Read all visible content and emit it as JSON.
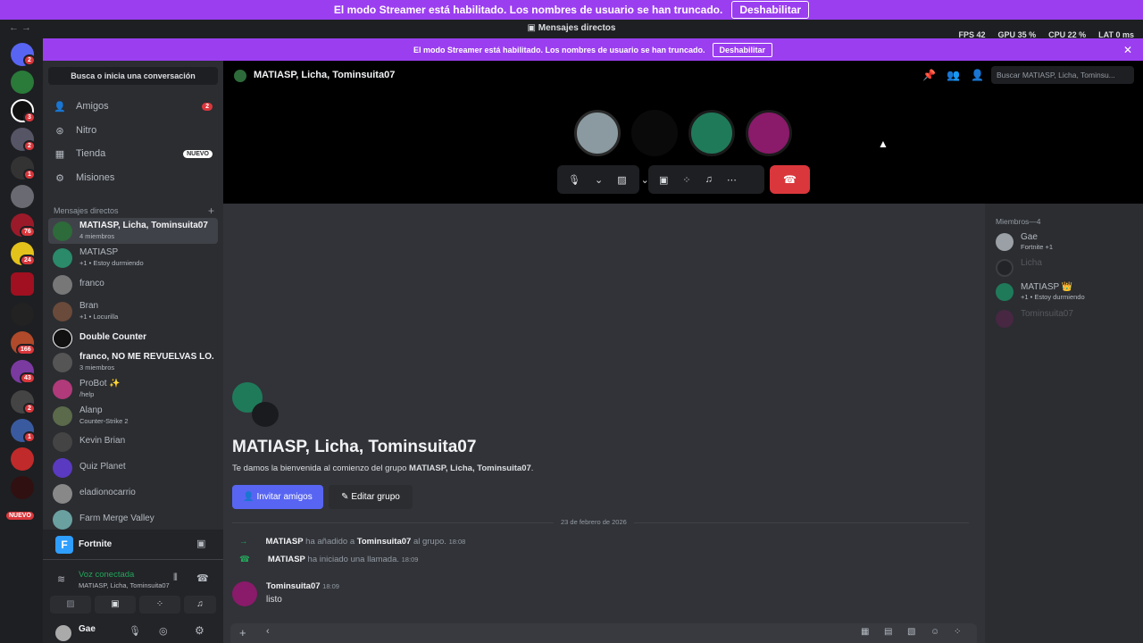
{
  "streamer_banner": {
    "text": "El modo Streamer está habilitado. Los nombres de usuario se han truncado.",
    "button": "Deshabilitar"
  },
  "window": {
    "title": "Mensajes directos",
    "nav": "← →"
  },
  "overlay": {
    "fps_label": "FPS",
    "fps": "42",
    "gpu_label": "GPU",
    "gpu": "35 %",
    "cpu_label": "CPU",
    "cpu": "22 %",
    "lat_label": "LAT",
    "lat": "0 ms"
  },
  "sidebar": {
    "search": "Busca o inicia una conversación",
    "nav": [
      {
        "label": "Amigos",
        "icon": "friends-icon",
        "badge": "2"
      },
      {
        "label": "Nitro",
        "icon": "nitro-icon"
      },
      {
        "label": "Tienda",
        "icon": "shop-icon",
        "tag": "NUEVO"
      },
      {
        "label": "Misiones",
        "icon": "quests-icon"
      }
    ],
    "dm_header": "Mensajes directos",
    "dms": [
      {
        "name": "MATIASP, Licha, Tominsuita07",
        "sub": "4 miembros"
      },
      {
        "name": "MATIASP",
        "sub": "+1 • Estoy durmiendo"
      },
      {
        "name": "franco",
        "sub": ""
      },
      {
        "name": "Bran",
        "sub": "+1 • Locurilla"
      },
      {
        "name": "Double Counter",
        "sub": ""
      },
      {
        "name": "franco, NO ME REVUELVAS LO...",
        "sub": "3 miembros"
      },
      {
        "name": "ProBot ✨",
        "sub": "/help"
      },
      {
        "name": "Alanp",
        "sub": "Counter-Strike 2"
      },
      {
        "name": "Kevin Brian",
        "sub": ""
      },
      {
        "name": "Quiz Planet",
        "sub": ""
      },
      {
        "name": "eladionocarrio",
        "sub": ""
      },
      {
        "name": "Farm Merge Valley",
        "sub": ""
      }
    ],
    "activity": "Fortnite",
    "voice": {
      "status": "Voz conectada",
      "channel": "MATIASP, Licha, Tominsuita07"
    },
    "user": {
      "name": "Gae"
    }
  },
  "guilds": {
    "badges": [
      "2",
      "3",
      "2",
      "1",
      "76",
      "24",
      "166",
      "43",
      "2",
      "1"
    ],
    "new_label": "NUEVO"
  },
  "call": {
    "header": "MATIASP, Licha, Tominsuita07",
    "search_placeholder": "Buscar MATIASP, Licha, Tominsu..."
  },
  "members": {
    "header": "Miembros—4",
    "list": [
      {
        "name": "Gae",
        "sub": "Fortnite +1"
      },
      {
        "name": "Licha",
        "sub": ""
      },
      {
        "name": "MATIASP 👑",
        "sub": "+1 • Estoy durmiendo"
      },
      {
        "name": "Tominsuita07",
        "sub": ""
      }
    ]
  },
  "chat": {
    "title": "MATIASP, Licha, Tominsuita07",
    "welcome_prefix": "Te damos la bienvenida al comienzo del grupo ",
    "welcome_group": "MATIASP, Licha, Tominsuita07",
    "welcome_suffix": ".",
    "invite": "Invitar amigos",
    "edit": "Editar grupo",
    "date": "23 de febrero de 2026",
    "sys1": {
      "user": "MATIASP",
      "mid": " ha añadido a ",
      "target": "Tominsuita07",
      "end": " al grupo. ",
      "time": "18:08"
    },
    "sys2": {
      "user": "MATIASP",
      "mid": " ha iniciado una llamada. ",
      "time": "18:09"
    },
    "msg": {
      "author": "Tominsuita07",
      "time": "18:09",
      "text": "listo"
    }
  }
}
